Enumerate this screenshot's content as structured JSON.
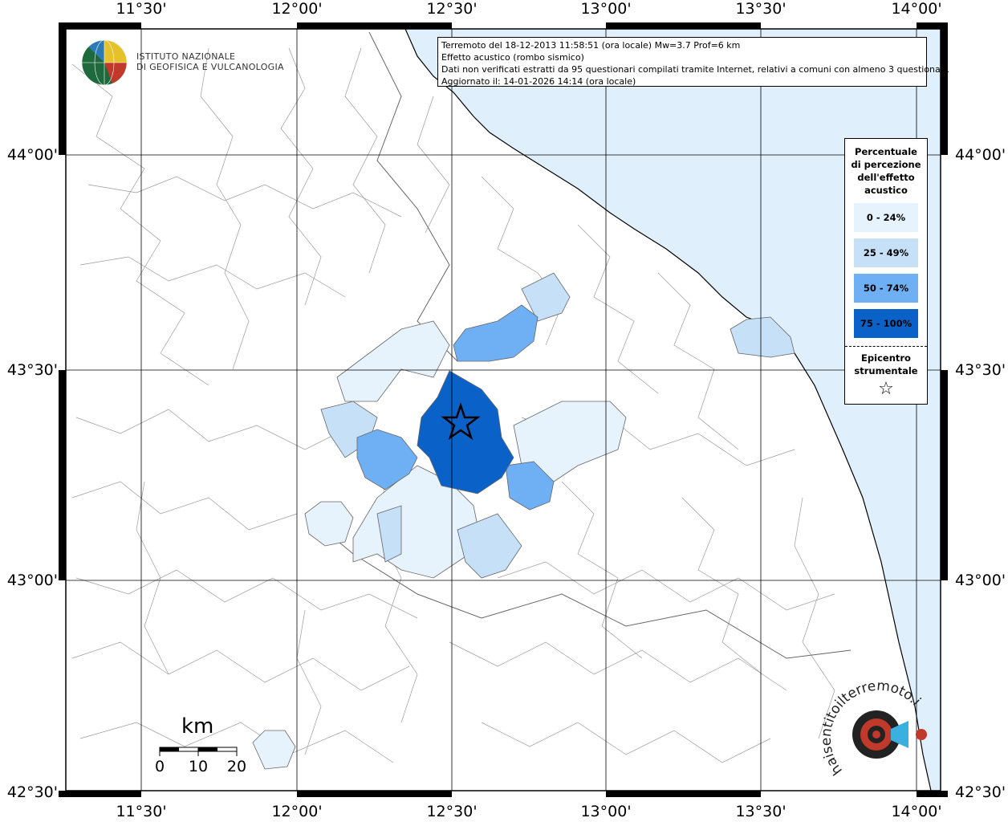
{
  "header": {
    "line1": "Terremoto del 18-12-2013 11:58:51 (ora locale) Mw=3.7 Prof=6 km",
    "line2": "Effetto acustico (rombo sismico)",
    "line3": "Dati non verificati estratti da 95 questionari compilati tramite Internet, relativi a comuni con almeno 3 questionari.",
    "line4": "Aggiornato il: 14-01-2026 14:14 (ora locale)"
  },
  "logo": {
    "line1": "ISTITUTO NAZIONALE",
    "line2": "DI GEOFISICA E VULCANOLOGIA",
    "icon": "ingv-globe-logo"
  },
  "axes": {
    "lon_ticks": [
      "11°30'",
      "12°00'",
      "12°30'",
      "13°00'",
      "13°30'",
      "14°00'"
    ],
    "lat_ticks": [
      "44°00'",
      "43°30'",
      "43°00'",
      "42°30'"
    ]
  },
  "legend": {
    "title_lines": [
      "Percentuale",
      "di percezione",
      "dell'effetto",
      "acustico"
    ],
    "items": [
      {
        "label": "0 - 24%",
        "color": "#e6f3fd"
      },
      {
        "label": "25 - 49%",
        "color": "#c6e0f8"
      },
      {
        "label": "50 - 74%",
        "color": "#6fb0f5"
      },
      {
        "label": "75 - 100%",
        "color": "#0a62c9"
      }
    ],
    "epicenter_lines": [
      "Epicentro",
      "strumentale"
    ],
    "epicenter_symbol": "☆"
  },
  "scale": {
    "unit": "km",
    "labels": [
      "0",
      "10",
      "20"
    ]
  },
  "colors": {
    "sea": "#dff0fc",
    "land": "#ffffff",
    "border": "#888888"
  },
  "watermark": {
    "text": "haisentitoilterremoto.it www.",
    "icon": "target-megaphone-logo"
  }
}
